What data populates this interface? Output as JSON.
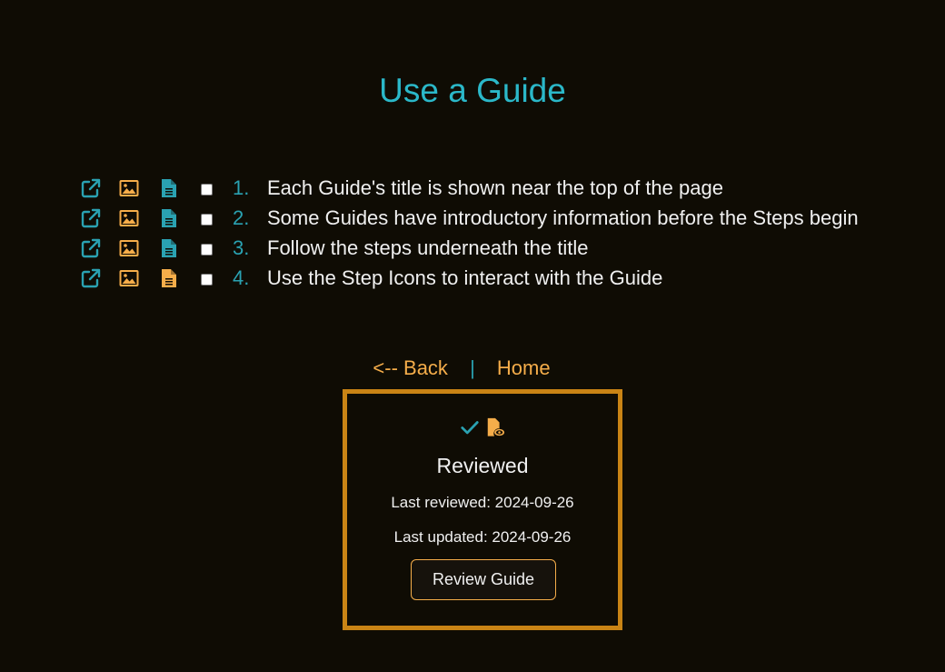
{
  "page": {
    "title": "Use a Guide"
  },
  "steps": [
    {
      "number": "1.",
      "text": "Each Guide's title is shown near the top of the page",
      "icons": [
        "external-link-icon",
        "image-icon",
        "document-icon"
      ],
      "document_icon_color": "#2aa2b2"
    },
    {
      "number": "2.",
      "text": "Some Guides have introductory information before the Steps begin",
      "icons": [
        "external-link-icon",
        "image-icon",
        "document-icon"
      ],
      "document_icon_color": "#2aa2b2"
    },
    {
      "number": "3.",
      "text": "Follow the steps underneath the title",
      "icons": [
        "external-link-icon",
        "image-icon",
        "document-icon"
      ],
      "document_icon_color": "#2aa2b2"
    },
    {
      "number": "4.",
      "text": "Use the Step Icons to interact with the Guide",
      "icons": [
        "external-link-icon",
        "image-icon",
        "document-icon"
      ],
      "document_icon_color": "#f5ad4a"
    }
  ],
  "nav": {
    "back_label": "<-- Back",
    "separator": "|",
    "home_label": "Home"
  },
  "review": {
    "icons": [
      "checkmark-icon",
      "document-eye-icon"
    ],
    "status": "Reviewed",
    "last_reviewed": "Last reviewed: 2024-09-26",
    "last_updated": "Last updated: 2024-09-26",
    "button_label": "Review Guide"
  },
  "colors": {
    "background": "#0f0c04",
    "title": "#2bb8c9",
    "accent_teal": "#2aa2b2",
    "accent_orange": "#f5ad4a",
    "box_border": "#c98415",
    "text": "#f0f0f0"
  }
}
